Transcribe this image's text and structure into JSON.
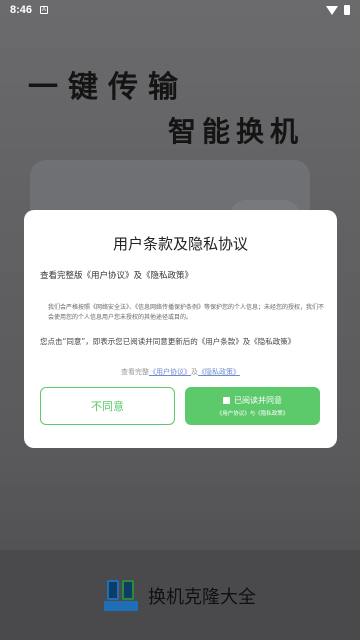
{
  "status_bar": {
    "time": "8:46",
    "notification_glyph": "A",
    "icons": [
      "wifi-icon",
      "battery-icon"
    ]
  },
  "splash": {
    "slogan_line1": "一键传输",
    "slogan_line2": "智能换机",
    "app_name": "换机克隆大全",
    "logo_text": "换机克隆"
  },
  "dialog": {
    "title": "用户条款及隐私协议",
    "line1": "查看完整版《用户协议》及《隐私政策》",
    "notice": "我们会严格按照《网络安全法》、《信息网络传播保护条例》等保护您的个人信息；未经您的授权，我们不会使用您的个人信息用户您未授权的其他途径或目的。",
    "line2": "您点击“同意”，即表示您已阅读并同意更新后的《用户条款》及《隐私政策》",
    "link_prefix": "查看完整",
    "link_user_agreement": "《用户协议》",
    "link_and": "及",
    "link_privacy": "《隐私政策》",
    "disagree_label": "不同意",
    "agree_label": "已阅读并同意",
    "agree_sub": "《用户协议》与《隐私政策》"
  },
  "colors": {
    "accent": "#5cc96a",
    "link": "#6f8bd0",
    "overlay": "#5c5c5e"
  }
}
